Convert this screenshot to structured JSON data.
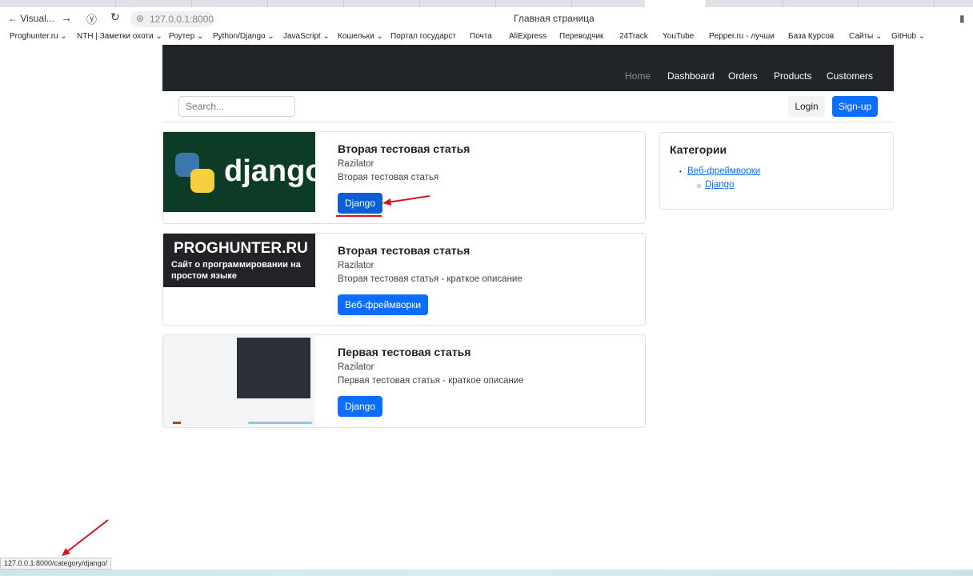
{
  "browser": {
    "back_label": "Visual...",
    "url": "127.0.0.1:8000",
    "page_title": "Главная страница",
    "bookmarks": [
      "Proghunter.ru ⌄",
      "NTH | Заметки охоти ⌄",
      "Роутер ⌄",
      "Python/Django ⌄",
      "JavaScript ⌄",
      "Кошельки ⌄",
      "Портал государст",
      "Почта",
      "AliExpress",
      "Переводчик",
      "24Track",
      "YouTube",
      "Pepper.ru - лучши",
      "База Курсов",
      "Сайты ⌄",
      "GitHub ⌄"
    ],
    "status_url": "127.0.0.1:8000/category/django/"
  },
  "nav": {
    "items": [
      "Home",
      "Dashboard",
      "Orders",
      "Products",
      "Customers"
    ]
  },
  "search": {
    "placeholder": "Search..."
  },
  "auth": {
    "login": "Login",
    "signup": "Sign-up"
  },
  "articles": [
    {
      "title": "Вторая тестовая статья",
      "author": "Razilator",
      "description": "Вторая тестовая статья",
      "category": "Django",
      "image_text": "django"
    },
    {
      "title": "Вторая тестовая статья",
      "author": "Razilator",
      "description": "Вторая тестовая статья - краткое описание",
      "category": "Веб-фреймворки",
      "image_text": "PROGHUNTER.RU",
      "image_subtext": "Сайт о программировании на простом языке"
    },
    {
      "title": "Первая тестовая статья",
      "author": "Razilator",
      "description": "Первая тестовая статья - краткое описание",
      "category": "Django"
    }
  ],
  "sidebar": {
    "title": "Категории",
    "categories": [
      {
        "label": "Веб-фреймворки"
      },
      {
        "label": "Django"
      }
    ]
  },
  "colors": {
    "primary": "#0d6efd",
    "navbar": "#212529",
    "annotation": "#d9141e"
  }
}
